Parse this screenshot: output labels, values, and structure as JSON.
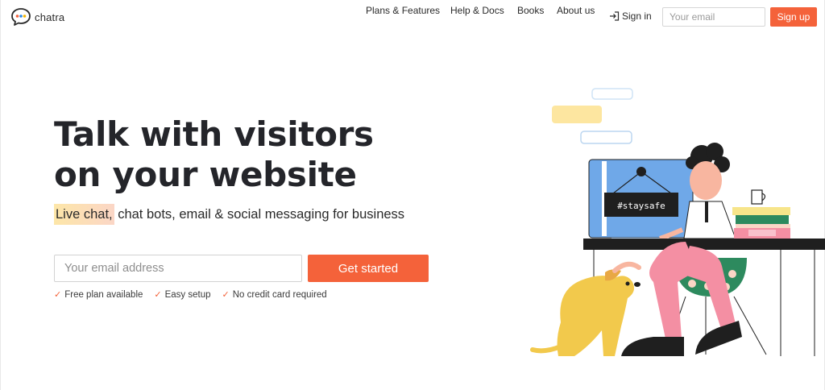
{
  "header": {
    "logo_text": "chatra",
    "nav": [
      {
        "label": "Plans & Features"
      },
      {
        "label": "Help & Docs"
      },
      {
        "label": "Books"
      },
      {
        "label": "About us"
      }
    ],
    "signin_label": "Sign in",
    "email_placeholder": "Your email",
    "signup_label": "Sign up"
  },
  "hero": {
    "title_line1": "Talk with visitors",
    "title_line2": "on your website",
    "subtitle_highlight": "Live chat,",
    "subtitle_rest": " chat bots, email & social messaging for business",
    "email_placeholder": "Your email address",
    "cta_label": "Get started",
    "features": [
      {
        "label": "Free plan available"
      },
      {
        "label": "Easy setup"
      },
      {
        "label": "No credit card required"
      }
    ]
  },
  "illustration": {
    "sign_text": "#staysafe"
  },
  "colors": {
    "accent": "#f4623a",
    "highlight_start": "#fde6a8",
    "highlight_end": "#fbd6c6",
    "monitor": "#6fa8e8",
    "dog": "#f2c94c",
    "pants": "#f48fa3",
    "cushion": "#2d8a5e"
  }
}
